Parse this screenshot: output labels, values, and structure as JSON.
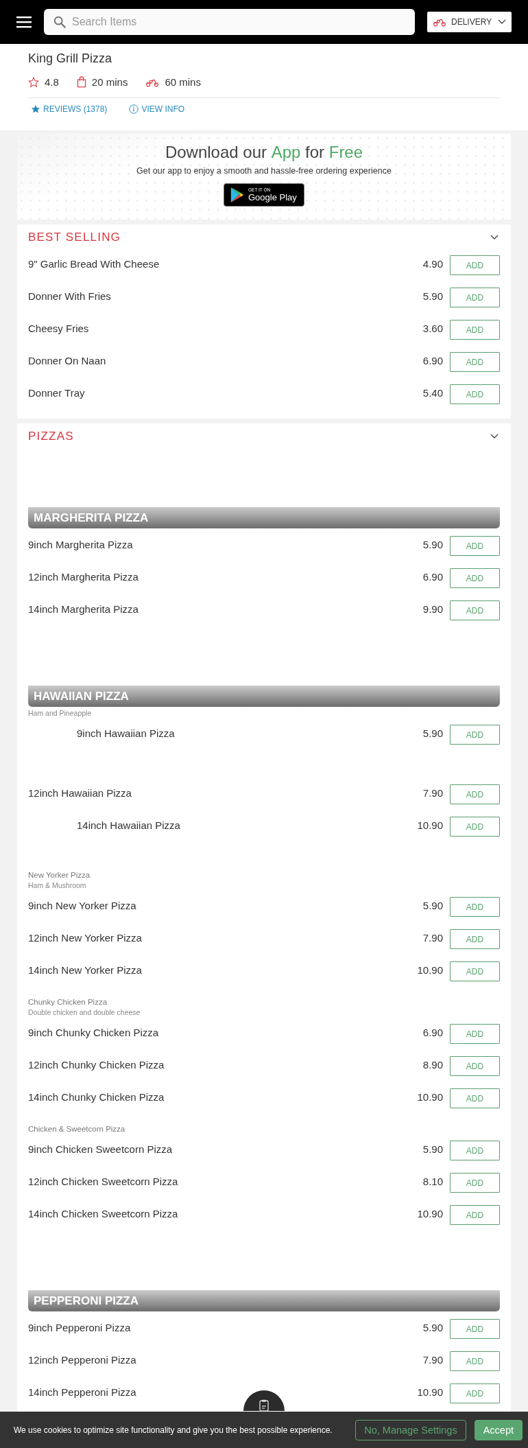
{
  "header": {
    "search": {
      "placeholder": "Search Items"
    },
    "order_mode": {
      "label": "DELIVERY"
    }
  },
  "restaurant": {
    "name": "King Grill Pizza",
    "rating": "4.8",
    "collection_time": "20 mins",
    "delivery_time": "60 mins",
    "links": [
      {
        "label": "REVIEWS (1378)",
        "kind": "reviews"
      },
      {
        "label": "VIEW INFO",
        "kind": "info"
      }
    ]
  },
  "app_banner": {
    "title": "Download our **App** for **Free**",
    "subtitle": "Get our app to enjoy a smooth and hassle-free ordering experience",
    "store_badge": {
      "small": "GET IT ON",
      "big": "Google Play"
    }
  },
  "sections": [
    {
      "title": "BEST SELLING",
      "expanded": true,
      "groups": [
        {
          "kind": "plain",
          "items": [
            {
              "name": "9\" Garlic Bread With Cheese",
              "price": "4.90",
              "button": "ADD",
              "indented": false
            },
            {
              "name": "Donner With Fries",
              "price": "5.90",
              "button": "ADD",
              "indented": false
            },
            {
              "name": "Cheesy Fries",
              "price": "3.60",
              "button": "ADD",
              "indented": false
            },
            {
              "name": "Donner On Naan",
              "price": "6.90",
              "button": "ADD",
              "indented": false
            },
            {
              "name": "Donner Tray",
              "price": "5.40",
              "button": "ADD",
              "indented": false
            }
          ]
        }
      ]
    },
    {
      "title": "PIZZAS",
      "expanded": true,
      "groups": [
        {
          "kind": "banner",
          "title": "MARGHERITA PIZZA",
          "items": [
            {
              "name": "9inch Margherita Pizza",
              "price": "5.90",
              "button": "ADD",
              "indented": false
            },
            {
              "name": "12inch Margherita Pizza",
              "price": "6.90",
              "button": "ADD",
              "indented": false
            },
            {
              "name": "14inch Margherita Pizza",
              "price": "9.90",
              "button": "ADD",
              "indented": false
            }
          ]
        },
        {
          "kind": "banner",
          "title": "HAWAIIAN PIZZA",
          "description": "Ham and Pineapple",
          "items": [
            {
              "name": "9inch Hawaiian Pizza",
              "price": "5.90",
              "button": "ADD",
              "indented": true
            },
            {
              "name": "12inch Hawaiian Pizza",
              "price": "7.90",
              "button": "ADD",
              "indented": false
            },
            {
              "name": "14inch Hawaiian Pizza",
              "price": "10.90",
              "button": "ADD",
              "indented": true
            }
          ]
        },
        {
          "kind": "subheading",
          "title": "New Yorker Pizza",
          "description": "Ham & Mushroom",
          "items": [
            {
              "name": "9inch New Yorker Pizza",
              "price": "5.90",
              "button": "ADD",
              "indented": false
            },
            {
              "name": "12inch New Yorker Pizza",
              "price": "7.90",
              "button": "ADD",
              "indented": false
            },
            {
              "name": "14inch New Yorker Pizza",
              "price": "10.90",
              "button": "ADD",
              "indented": false
            }
          ]
        },
        {
          "kind": "subheading",
          "title": "Chunky Chicken Pizza",
          "description": "Double chicken and double cheese",
          "items": [
            {
              "name": "9inch Chunky Chicken Pizza",
              "price": "6.90",
              "button": "ADD",
              "indented": false
            },
            {
              "name": "12inch Chunky Chicken Pizza",
              "price": "8.90",
              "button": "ADD",
              "indented": false
            },
            {
              "name": "14inch Chunky Chicken Pizza",
              "price": "10.90",
              "button": "ADD",
              "indented": false
            }
          ]
        },
        {
          "kind": "subheading",
          "title": "Chicken & Sweetcorn Pizza",
          "items": [
            {
              "name": "9inch Chicken Sweetcorn Pizza",
              "price": "5.90",
              "button": "ADD",
              "indented": false
            },
            {
              "name": "12inch Chicken Sweetcorn Pizza",
              "price": "8.10",
              "button": "ADD",
              "indented": false
            },
            {
              "name": "14inch Chicken Sweetcorn Pizza",
              "price": "10.90",
              "button": "ADD",
              "indented": false
            }
          ]
        },
        {
          "kind": "banner",
          "title": "PEPPERONI PIZZA",
          "items": [
            {
              "name": "9inch Pepperoni Pizza",
              "price": "5.90",
              "button": "ADD",
              "indented": false
            },
            {
              "name": "12inch Pepperoni Pizza",
              "price": "7.90",
              "button": "ADD",
              "indented": false
            },
            {
              "name": "14inch Pepperoni Pizza",
              "price": "10.90",
              "button": "ADD",
              "indented": false
            }
          ]
        }
      ]
    }
  ],
  "cookie_bar": {
    "text": "We use cookies to optimize site functionality and give you the best possible experience.",
    "buttons": [
      {
        "label": "No, Manage Settings",
        "kind": "secondary"
      },
      {
        "label": "Accept",
        "kind": "primary"
      }
    ]
  }
}
